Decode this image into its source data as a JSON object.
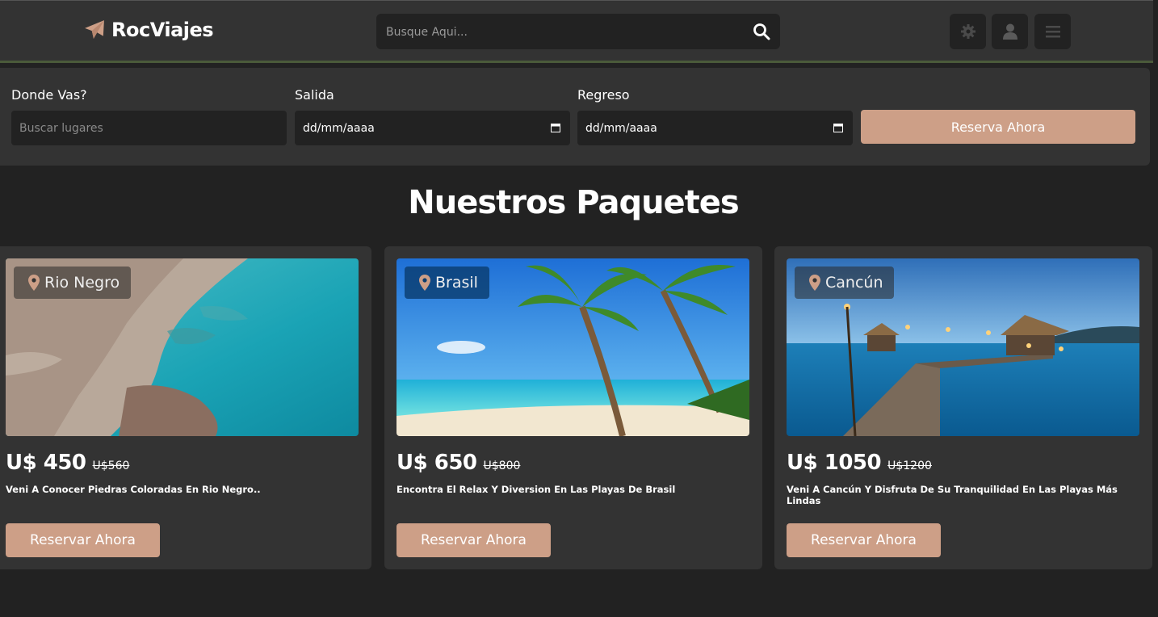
{
  "header": {
    "logo_text": "RocViajes",
    "search_placeholder": "Busque Aqui...",
    "icons": [
      "gear-icon",
      "user-icon",
      "menu-icon"
    ]
  },
  "booking": {
    "destination_label": "Donde Vas?",
    "destination_placeholder": "Buscar lugares",
    "departure_label": "Salida",
    "departure_value": "dd/mm/aaaa",
    "return_label": "Regreso",
    "return_value": "dd/mm/aaaa",
    "submit_label": "Reserva Ahora"
  },
  "section_title": "Nuestros Paquetes",
  "packages": [
    {
      "location": "Rio Negro",
      "price": "U$ 450",
      "old_price": "U$560",
      "description": "Veni A Conocer Piedras Coloradas En Rio Negro..",
      "button": "Reservar Ahora"
    },
    {
      "location": "Brasil",
      "price": "U$ 650",
      "old_price": "U$800",
      "description": "Encontra El Relax Y Diversion En Las Playas De Brasil",
      "button": "Reservar Ahora"
    },
    {
      "location": "Cancún",
      "price": "U$ 1050",
      "old_price": "U$1200",
      "description": "Veni A Cancún Y Disfruta De Su Tranquilidad En Las Playas Más Lindas",
      "button": "Reservar Ahora"
    }
  ],
  "colors": {
    "accent": "#cd9f87",
    "background": "#222222",
    "panel": "#333333"
  }
}
